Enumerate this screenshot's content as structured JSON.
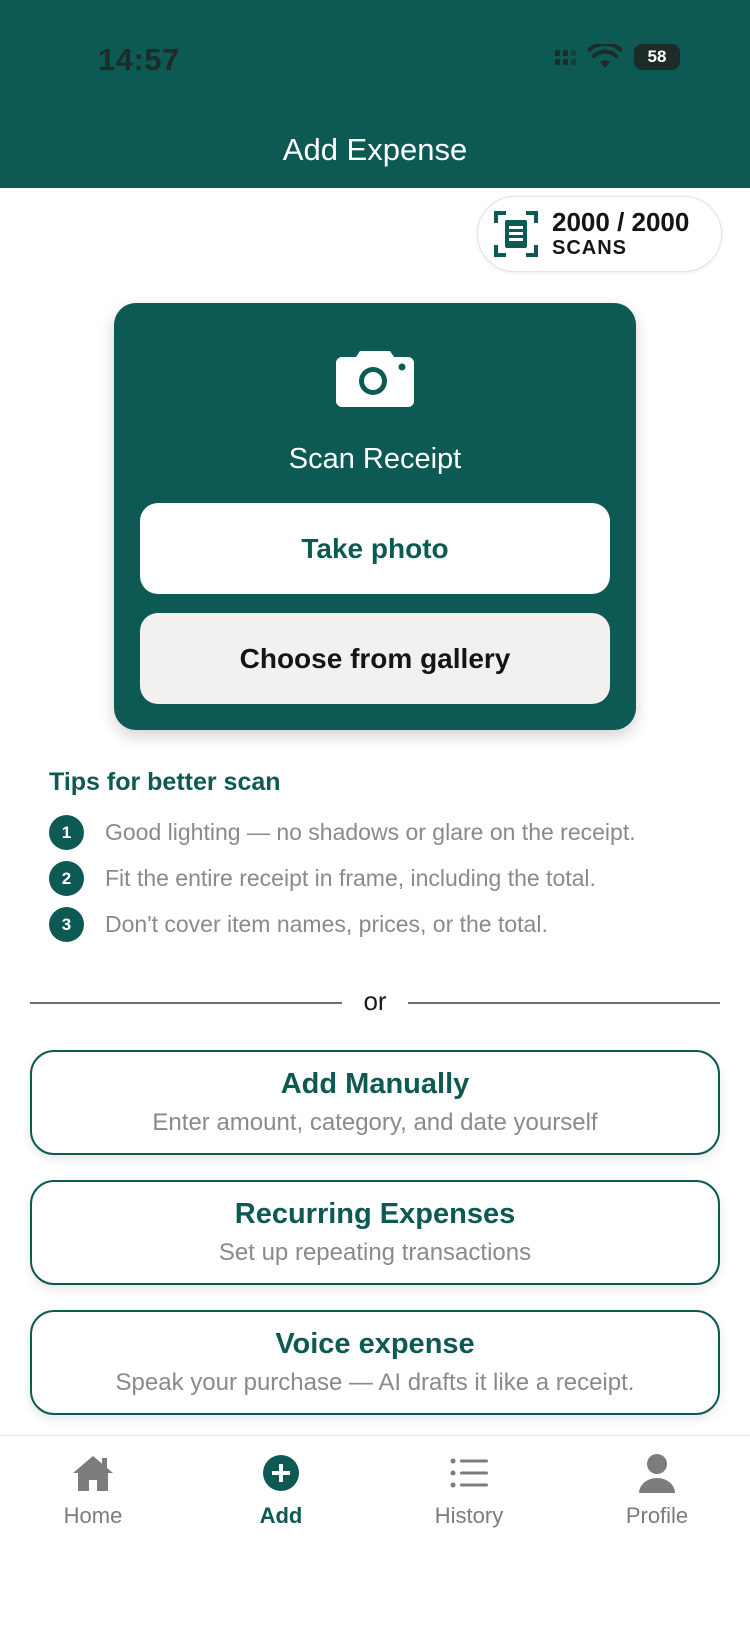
{
  "status_bar": {
    "time": "14:57",
    "battery": "58",
    "icons": [
      "signal-icon",
      "wifi-icon",
      "battery-icon"
    ]
  },
  "header": {
    "title": "Add Expense",
    "color": "#0c5a53"
  },
  "scans": {
    "count": "2000 / 2000",
    "label": "SCANS",
    "icon": "receipt-scan-icon"
  },
  "scan_card": {
    "icon": "camera-icon",
    "title": "Scan Receipt",
    "take_photo": "Take photo",
    "choose_gallery": "Choose from gallery"
  },
  "tips": {
    "title": "Tips for better scan",
    "items": [
      {
        "num": "1",
        "text": "Good lighting — no shadows or glare on the receipt."
      },
      {
        "num": "2",
        "text": "Fit the entire receipt in frame, including the total."
      },
      {
        "num": "3",
        "text": "Don't cover item names, prices, or the total."
      }
    ]
  },
  "divider": {
    "text": "or"
  },
  "options": [
    {
      "title": "Add Manually",
      "subtitle": "Enter amount, category, and date yourself"
    },
    {
      "title": "Recurring Expenses",
      "subtitle": "Set up repeating transactions"
    },
    {
      "title": "Voice expense",
      "subtitle": "Speak your purchase — AI drafts it like a receipt."
    }
  ],
  "tabbar": {
    "items": [
      {
        "label": "Home",
        "icon": "home-icon",
        "active": false
      },
      {
        "label": "Add",
        "icon": "add-circle-icon",
        "active": true
      },
      {
        "label": "History",
        "icon": "list-icon",
        "active": false
      },
      {
        "label": "Profile",
        "icon": "person-icon",
        "active": false
      }
    ]
  },
  "colors": {
    "primary": "#0c5a53",
    "muted_text": "#8a8a8a",
    "gallery_button_bg": "#f2f1ef"
  }
}
